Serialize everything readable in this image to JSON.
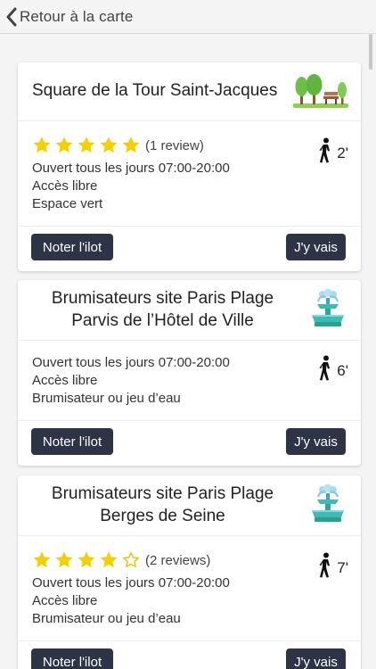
{
  "header": {
    "back_label": "Retour à la carte",
    "back_icon": "chevron-left-icon"
  },
  "colors": {
    "button_bg": "#2c3446",
    "star": "#f5d000",
    "background": "#f4f4f4"
  },
  "cards": [
    {
      "title_lines": [
        "Square de la Tour Saint-Jacques"
      ],
      "icon": "park-icon",
      "rating": 5,
      "review_text": "(1 review)",
      "hours": "Ouvert tous les jours 07:00-20:00",
      "access": "Accès libre",
      "category": "Espace vert",
      "walk_time": "2'",
      "rate_button": "Noter l'ilot",
      "go_button": "J'y vais"
    },
    {
      "title_lines": [
        "Brumisateurs site Paris Plage",
        "Parvis de l’Hôtel de Ville"
      ],
      "icon": "fountain-icon",
      "rating": null,
      "review_text": "",
      "hours": "Ouvert tous les jours 07:00-20:00",
      "access": "Accès libre",
      "category": "Brumisateur ou jeu d’eau",
      "walk_time": "6'",
      "rate_button": "Noter l'ilot",
      "go_button": "J'y vais"
    },
    {
      "title_lines": [
        "Brumisateurs site Paris Plage",
        "Berges de Seine"
      ],
      "icon": "fountain-icon",
      "rating": 4,
      "review_text": "(2 reviews)",
      "hours": "Ouvert tous les jours 07:00-20:00",
      "access": "Accès libre",
      "category": "Brumisateur ou jeu d’eau",
      "walk_time": "7'",
      "rate_button": "Noter l'ilot",
      "go_button": "J'y vais"
    }
  ]
}
